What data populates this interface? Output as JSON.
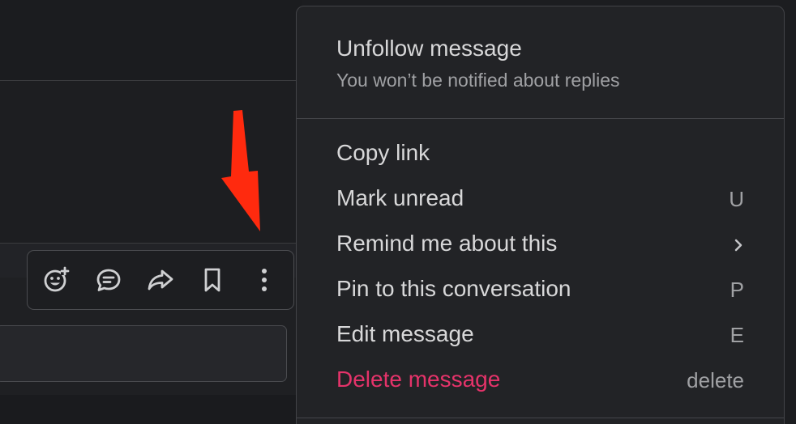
{
  "toolbar": {
    "buttons": [
      {
        "name": "add-reaction",
        "icon": "emoji-add-icon"
      },
      {
        "name": "reply-in-thread",
        "icon": "thread-reply-icon"
      },
      {
        "name": "forward-message",
        "icon": "share-arrow-icon"
      },
      {
        "name": "save-for-later",
        "icon": "bookmark-icon"
      },
      {
        "name": "more-actions",
        "icon": "vertical-ellipsis-icon"
      }
    ]
  },
  "annotation": {
    "arrow_color": "#ff2a0e",
    "points_to": "more-actions"
  },
  "menu": {
    "header": {
      "title": "Unfollow message",
      "subtitle": "You won’t be notified about replies"
    },
    "items": [
      {
        "label": "Copy link",
        "shortcut": ""
      },
      {
        "label": "Mark unread",
        "shortcut": "U"
      },
      {
        "label": "Remind me about this",
        "shortcut": "",
        "submenu_icon": "chevron-right-icon"
      },
      {
        "label": "Pin to this conversation",
        "shortcut": "P"
      },
      {
        "label": "Edit message",
        "shortcut": "E"
      },
      {
        "label": "Delete message",
        "shortcut": "delete",
        "danger": true
      }
    ]
  },
  "colors": {
    "background": "#1c1d20",
    "menu_background": "#222326",
    "text": "#d8d8d9",
    "muted_text": "#a0a1a4",
    "danger": "#e5336a"
  }
}
